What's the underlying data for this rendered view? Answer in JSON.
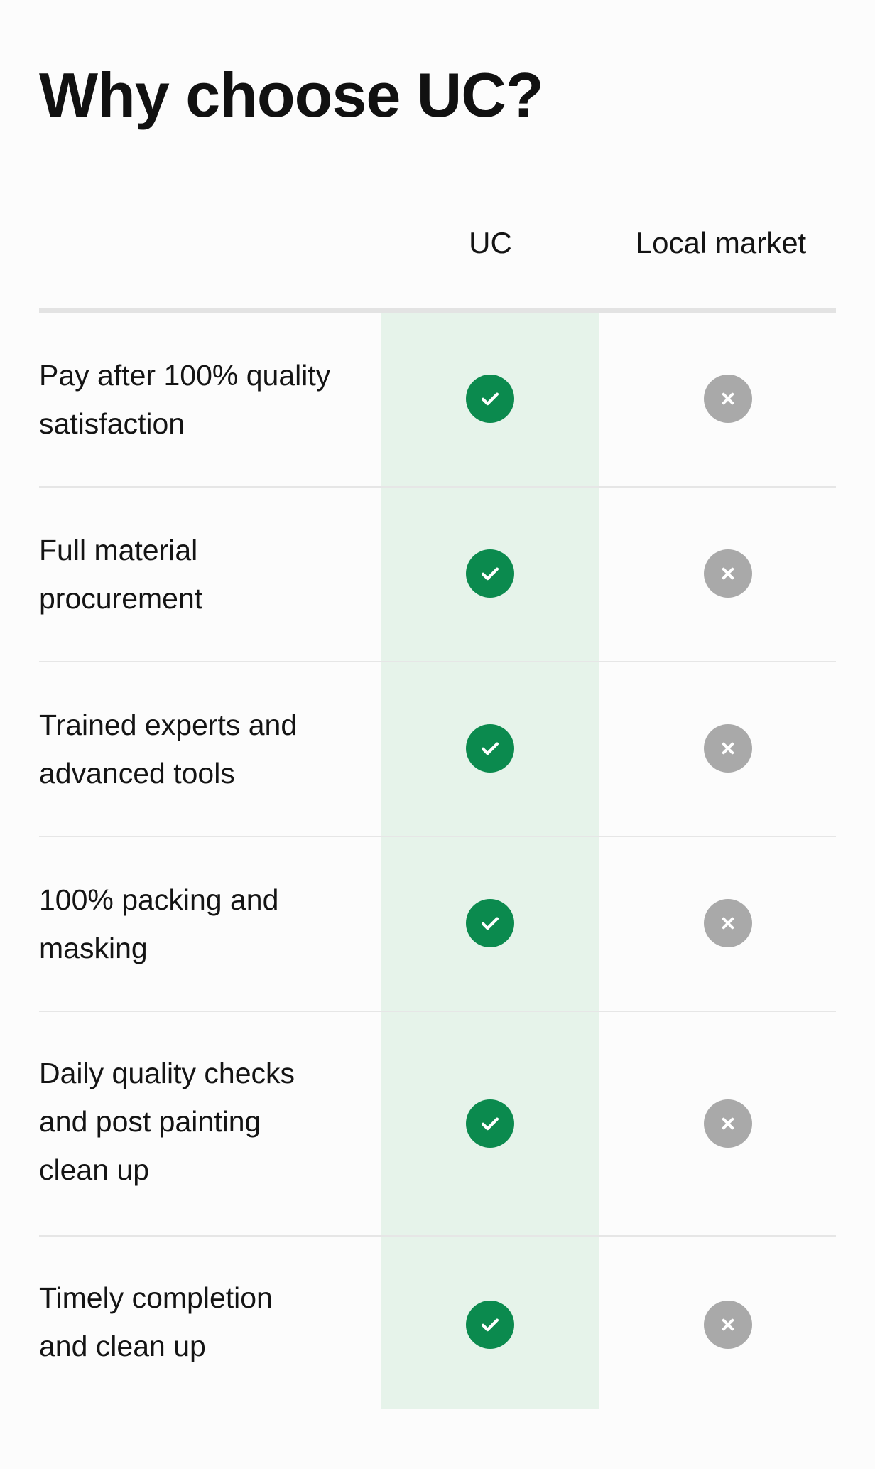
{
  "page": {
    "title": "Why choose UC?"
  },
  "table": {
    "columns": [
      "UC",
      "Local market"
    ],
    "accent_color": "#0b8a4e",
    "highlight_color": "#e6f3ea",
    "negative_color": "#a9a9a9",
    "rows": [
      {
        "feature": "Pay after 100% quality satisfaction",
        "uc": "check-icon",
        "local_market": "cross-icon"
      },
      {
        "feature": "Full material procurement",
        "uc": "check-icon",
        "local_market": "cross-icon"
      },
      {
        "feature": "Trained experts and advanced tools",
        "uc": "check-icon",
        "local_market": "cross-icon"
      },
      {
        "feature": "100% packing and masking",
        "uc": "check-icon",
        "local_market": "cross-icon"
      },
      {
        "feature": "Daily quality checks and post painting clean up",
        "uc": "check-icon",
        "local_market": "cross-icon"
      },
      {
        "feature": "Timely completion and clean up",
        "uc": "check-icon",
        "local_market": "cross-icon"
      }
    ]
  }
}
